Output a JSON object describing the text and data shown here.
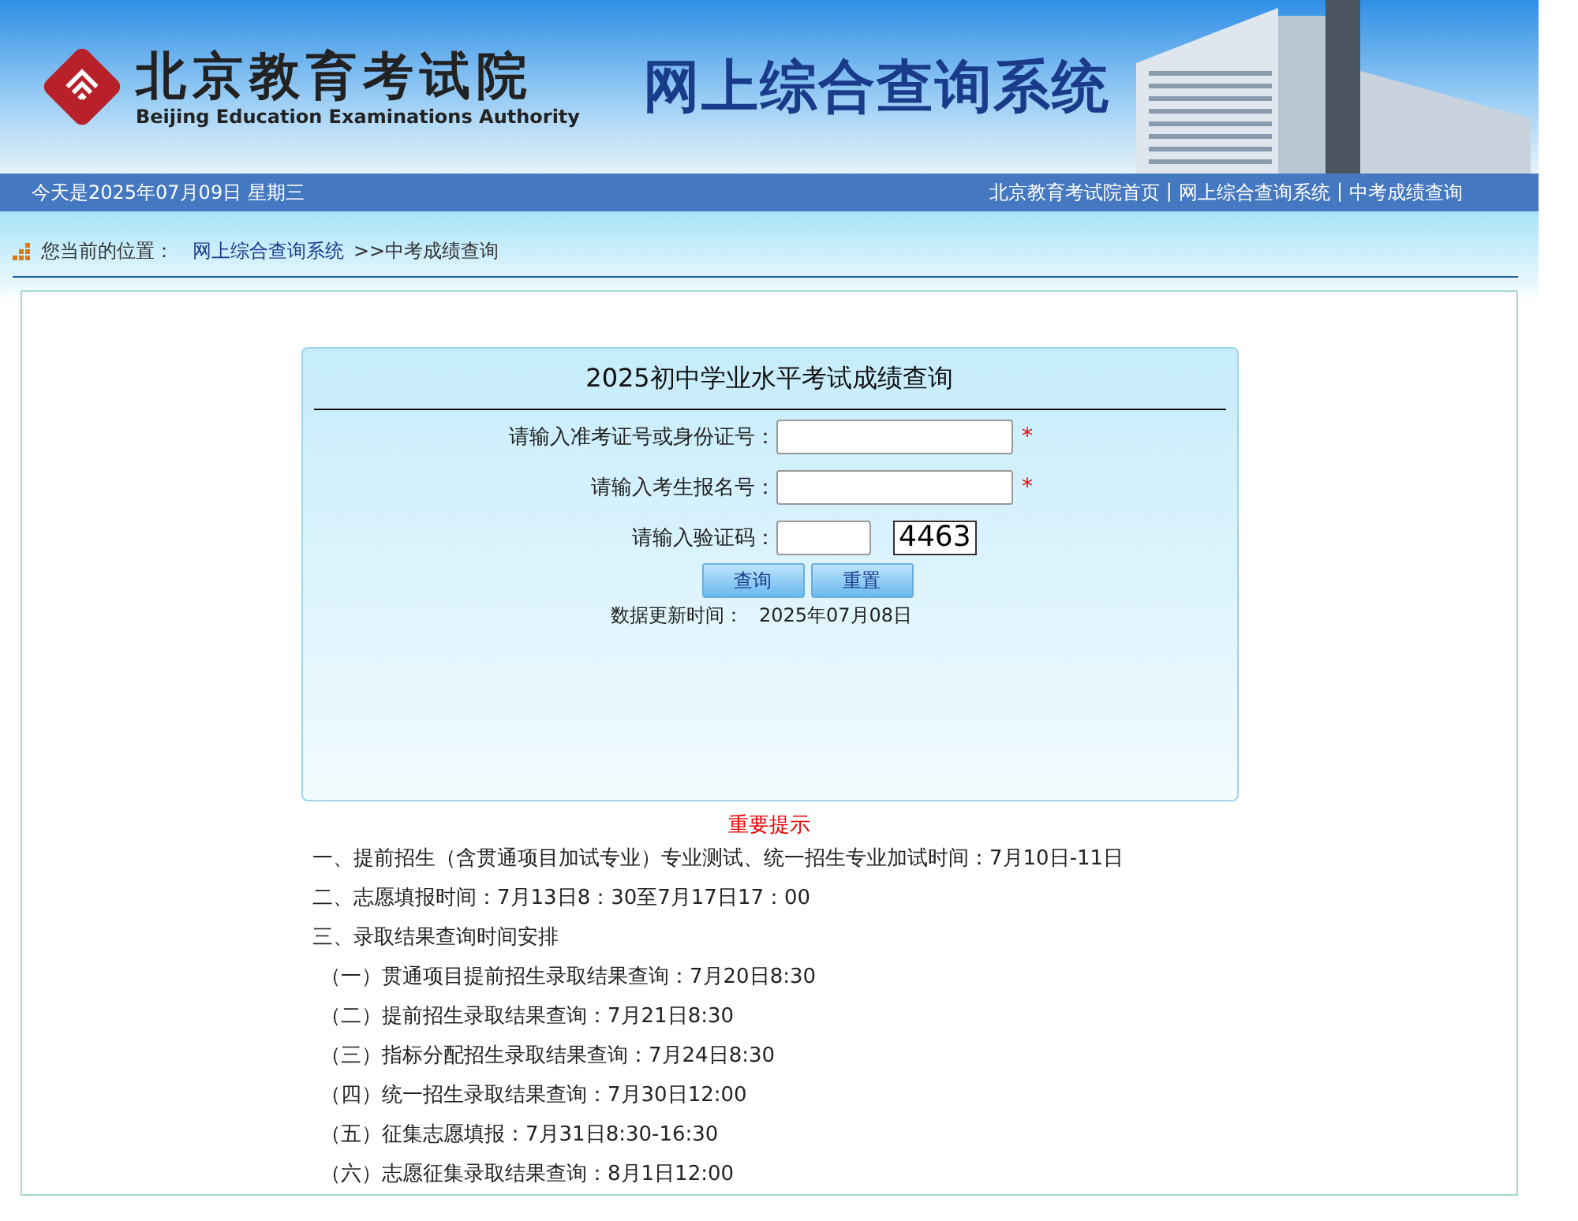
{
  "banner": {
    "org_name": "北京教育考试院",
    "org_name_en": "Beijing Education Examinations Authority",
    "system_title": "网上综合查询系统"
  },
  "top_bar": {
    "date": "今天是2025年07月09日  星期三",
    "links": [
      "北京教育考试院首页",
      "网上综合查询系统",
      "中考成绩查询"
    ],
    "separator": "|"
  },
  "breadcrumb": {
    "label": "您当前的位置：",
    "link": "网上综合查询系统",
    "current": ">>中考成绩查询"
  },
  "form": {
    "title": "2025初中学业水平考试成绩查询",
    "fields": [
      {
        "label": "请输入准考证号或身份证号：",
        "kind": "text",
        "required": true
      },
      {
        "label": "请输入考生报名号：",
        "kind": "text",
        "required": true
      },
      {
        "label": "请输入验证码：",
        "kind": "captcha",
        "required": false,
        "captcha": "4463"
      }
    ],
    "required_mark": "*",
    "buttons": [
      "查询",
      "重置"
    ],
    "update_label": "数据更新时间：",
    "update_value": "2025年07月08日"
  },
  "notice": {
    "title": "重要提示",
    "items": [
      {
        "kind": "section",
        "text": "一、提前招生（含贯通项目加试专业）专业测试、统一招生专业加试时间：7月10日-11日"
      },
      {
        "kind": "section",
        "text": "二、志愿填报时间：7月13日8：30至7月17日17：00"
      },
      {
        "kind": "section",
        "text": "三、录取结果查询时间安排"
      },
      {
        "kind": "sub",
        "text": "（一）贯通项目提前招生录取结果查询：7月20日8:30"
      },
      {
        "kind": "sub",
        "text": "（二）提前招生录取结果查询：7月21日8:30"
      },
      {
        "kind": "sub",
        "text": "（三）指标分配招生录取结果查询：7月24日8:30"
      },
      {
        "kind": "sub",
        "text": "（四）统一招生录取结果查询：7月30日12:00"
      },
      {
        "kind": "sub",
        "text": "（五）征集志愿填报：7月31日8:30-16:30"
      },
      {
        "kind": "sub",
        "text": "（六）志愿征集录取结果查询：8月1日12:00"
      }
    ]
  }
}
